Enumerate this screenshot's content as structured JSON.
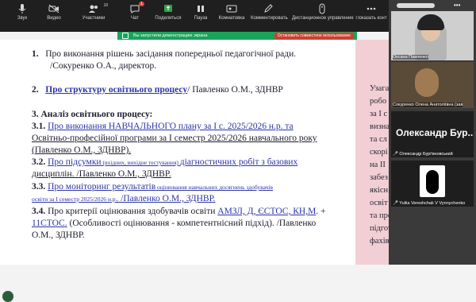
{
  "toolbar": {
    "items": [
      {
        "label": "Звук",
        "icon": "microphone-icon"
      },
      {
        "label": "Видео",
        "icon": "video-camera-icon"
      },
      {
        "label": "Участники",
        "icon": "participants-icon",
        "count": "18"
      },
      {
        "label": "Чат",
        "icon": "chat-icon",
        "badge": "1"
      },
      {
        "label": "Поделиться",
        "icon": "share-screen-icon"
      },
      {
        "label": "Пауза",
        "icon": "pause-icon"
      },
      {
        "label": "Комнатовка",
        "icon": "remote-icon"
      },
      {
        "label": "Комментировать",
        "icon": "annotate-icon"
      },
      {
        "label": "Дистанционное управление",
        "icon": "remote-control-icon"
      },
      {
        "label": "Показать конт",
        "icon": "more-icon"
      }
    ]
  },
  "demo_bar": {
    "text": "Вы запустили демонстрацию экрана",
    "stop_label": "Остановить совместное использование"
  },
  "slide": {
    "item1_num": "1.",
    "item1_line1": "Про виконання рішень засідання попередньої педагогічної ради.",
    "item1_line2": "/Сокуренко О.А., директор.",
    "item2_num": "2.",
    "item2_link": "Про структуру освітнього процесу",
    "item2_rest": "/ Павленко О.М., ЗДНВР",
    "item3_heading": "3. Аналіз освітнього процесу:",
    "item31_num": "3.1.",
    "item31_line1": "Про виконання НАВЧАЛЬНОГО  плану за І с. 2025/2026 н.р. та",
    "item31_line2": "Освітньо-професійної програми за І семестр 2025/2026 навчального року",
    "item31_line3": "(Павленко О.М., ЗДНВР).",
    "item32_num": "3.2.",
    "item32_link1": "Про підсумки",
    "item32_small": " (вхідних, вихідне тестування) ",
    "item32_link2": "діагностичних робіт з базових",
    "item32_line2": "дисциплін. /Павленко О.М., ЗДНВР.",
    "item33_num": "3.3.",
    "item33_link1": "Про моніторинг результатів",
    "item33_small1": " оцінювання навчальних досягнень здобувачів",
    "item33_small2": "освіти за І семестр 2025/2026 н.р.,",
    "item33_rest": " /Павленко О.М., ЗДНВР.",
    "item34_num": "3.4.",
    "item34_text1": "Про критерії оцінювання здобувачів освіти ",
    "item34_link1": "АМЗЛ, Д, ЄСТОС, КН,М",
    "item34_plus": ". +",
    "item34_link2": "11СТОС.",
    "item34_text2": " (Особливості оцінювання - компетентнісний підхід). /Павленко",
    "item34_line3": "О.М., ЗДНВР.",
    "side_lines": [
      "Узага",
      "робо",
      "за І с",
      "визна",
      "та сл",
      "скорі",
      "на ІІ",
      "забез",
      "якісн",
      "освіт",
      "та професійної",
      "підготовки",
      "фахівців"
    ]
  },
  "participants": [
    {
      "name": "Оксана Павленко"
    },
    {
      "name": "Сокуренко Олена Анатоліївна (зав"
    },
    {
      "name": "Олександр Бур...",
      "label": "Олександр Бурґиновський"
    },
    {
      "name": "Yuliia Vereshchak V Vynnychenko"
    }
  ]
}
